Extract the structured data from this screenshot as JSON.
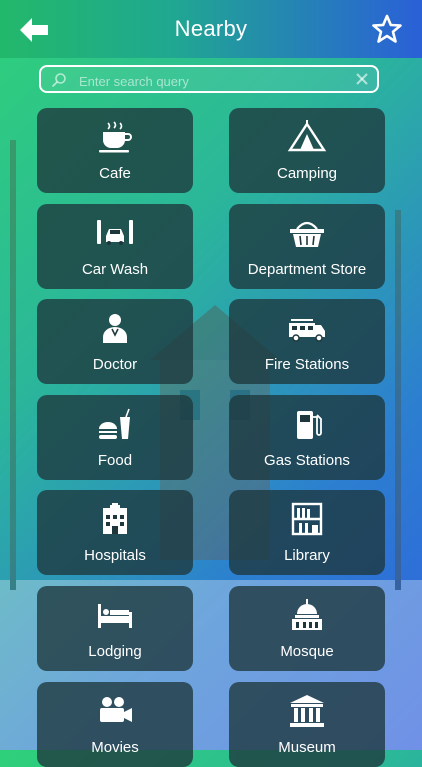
{
  "header": {
    "title": "Nearby",
    "back_icon": "arrow-left-icon",
    "favorite_icon": "star-icon"
  },
  "search": {
    "placeholder": "Enter search query",
    "value": "",
    "search_icon": "magnifier-icon",
    "clear_icon": "close-icon"
  },
  "categories": [
    {
      "label": "Cafe",
      "icon": "coffee-cup-icon"
    },
    {
      "label": "Camping",
      "icon": "tent-icon"
    },
    {
      "label": "Car Wash",
      "icon": "car-wash-icon"
    },
    {
      "label": "Department Store",
      "icon": "shopping-basket-icon"
    },
    {
      "label": "Doctor",
      "icon": "doctor-icon"
    },
    {
      "label": "Fire Stations",
      "icon": "fire-truck-icon"
    },
    {
      "label": "Food",
      "icon": "burger-drink-icon"
    },
    {
      "label": "Gas Stations",
      "icon": "gas-pump-icon"
    },
    {
      "label": "Hospitals",
      "icon": "hospital-building-icon"
    },
    {
      "label": "Library",
      "icon": "bookshelf-icon"
    },
    {
      "label": "Lodging",
      "icon": "bed-icon"
    },
    {
      "label": "Mosque",
      "icon": "dome-building-icon"
    },
    {
      "label": "Movies",
      "icon": "movie-camera-icon"
    },
    {
      "label": "Museum",
      "icon": "museum-icon"
    }
  ]
}
